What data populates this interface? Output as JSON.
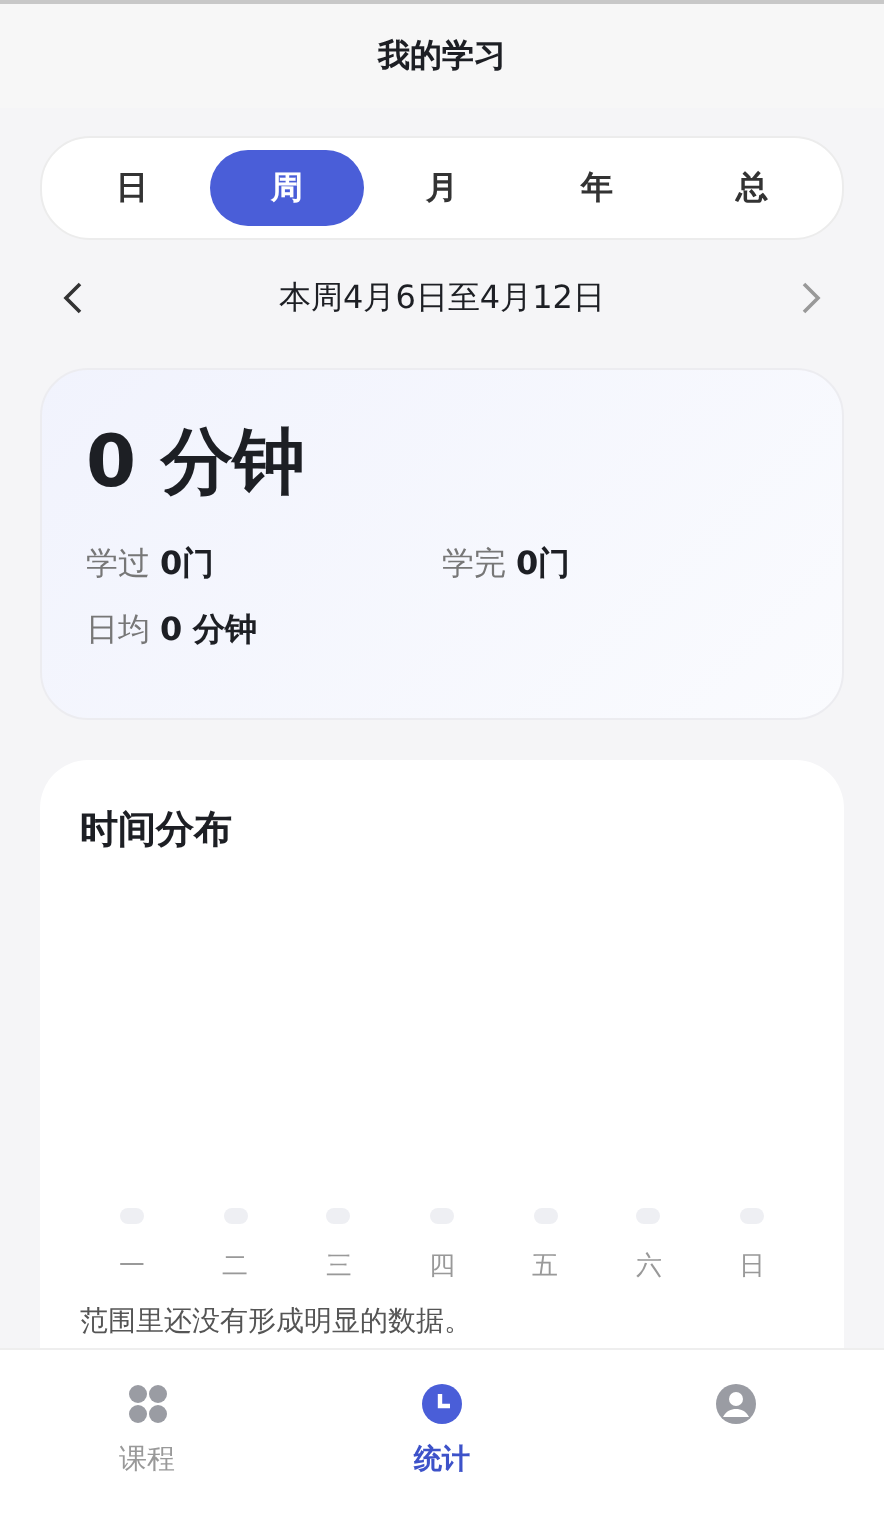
{
  "header": {
    "title": "我的学习"
  },
  "period_tabs": [
    {
      "label": "日",
      "selected": false
    },
    {
      "label": "周",
      "selected": true
    },
    {
      "label": "月",
      "selected": false
    },
    {
      "label": "年",
      "selected": false
    },
    {
      "label": "总",
      "selected": false
    }
  ],
  "date_range": {
    "text": "本周4月6日至4月12日"
  },
  "summary": {
    "total": "0 分钟",
    "stats": [
      {
        "label": "学过",
        "value": "0门"
      },
      {
        "label": "学完",
        "value": "0门"
      },
      {
        "label": "日均",
        "value": "0 分钟"
      }
    ]
  },
  "time_distribution": {
    "title": "时间分布",
    "days": [
      "一",
      "二",
      "三",
      "四",
      "五",
      "六",
      "日"
    ],
    "note": "范围里还没有形成明显的数据。"
  },
  "bottom_nav": [
    {
      "kind": "courses",
      "label": "课程",
      "selected": false
    },
    {
      "kind": "stats",
      "label": "统计",
      "selected": true
    },
    {
      "kind": "profile",
      "selected": false
    }
  ]
}
